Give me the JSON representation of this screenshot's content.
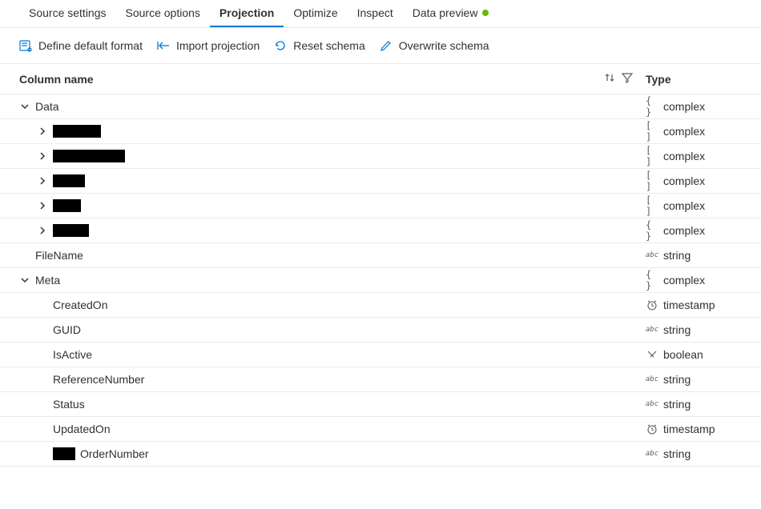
{
  "tabs": [
    {
      "label": "Source settings",
      "active": false
    },
    {
      "label": "Source options",
      "active": false
    },
    {
      "label": "Projection",
      "active": true
    },
    {
      "label": "Optimize",
      "active": false
    },
    {
      "label": "Inspect",
      "active": false
    },
    {
      "label": "Data preview",
      "active": false,
      "dot": true
    }
  ],
  "toolbar": {
    "define_format": "Define default format",
    "import_projection": "Import projection",
    "reset_schema": "Reset schema",
    "overwrite_schema": "Overwrite schema"
  },
  "headers": {
    "column_name": "Column name",
    "type": "Type"
  },
  "rows": [
    {
      "name": "Data",
      "type": "complex",
      "icon": "{}",
      "chev": "down",
      "indent": 0,
      "redact": false
    },
    {
      "name": "",
      "type": "complex",
      "icon": "[]",
      "chev": "right",
      "indent": 1,
      "redact": true,
      "w": 60
    },
    {
      "name": "",
      "type": "complex",
      "icon": "[]",
      "chev": "right",
      "indent": 1,
      "redact": true,
      "w": 90
    },
    {
      "name": "",
      "type": "complex",
      "icon": "[]",
      "chev": "right",
      "indent": 1,
      "redact": true,
      "w": 40
    },
    {
      "name": "",
      "type": "complex",
      "icon": "[]",
      "chev": "right",
      "indent": 1,
      "redact": true,
      "w": 35
    },
    {
      "name": "",
      "type": "complex",
      "icon": "{}",
      "chev": "right",
      "indent": 1,
      "redact": true,
      "w": 45
    },
    {
      "name": "FileName",
      "type": "string",
      "icon": "abc",
      "chev": "",
      "indent": 0,
      "redact": false
    },
    {
      "name": "Meta",
      "type": "complex",
      "icon": "{}",
      "chev": "down",
      "indent": 0,
      "redact": false
    },
    {
      "name": "CreatedOn",
      "type": "timestamp",
      "icon": "ts",
      "chev": "",
      "indent": 1,
      "redact": false
    },
    {
      "name": "GUID",
      "type": "string",
      "icon": "abc",
      "chev": "",
      "indent": 1,
      "redact": false
    },
    {
      "name": "IsActive",
      "type": "boolean",
      "icon": "bool",
      "chev": "",
      "indent": 1,
      "redact": false
    },
    {
      "name": "ReferenceNumber",
      "type": "string",
      "icon": "abc",
      "chev": "",
      "indent": 1,
      "redact": false
    },
    {
      "name": "Status",
      "type": "string",
      "icon": "abc",
      "chev": "",
      "indent": 1,
      "redact": false
    },
    {
      "name": "UpdatedOn",
      "type": "timestamp",
      "icon": "ts",
      "chev": "",
      "indent": 1,
      "redact": false
    },
    {
      "name": "OrderNumber",
      "type": "string",
      "icon": "abc",
      "chev": "",
      "indent": 1,
      "redact": false,
      "prefix_redact": 28
    }
  ]
}
